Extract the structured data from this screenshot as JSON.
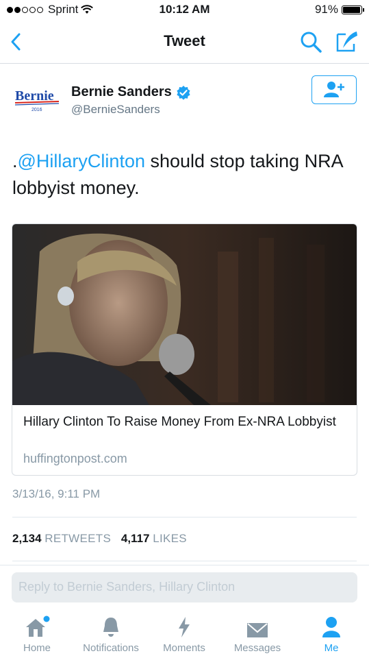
{
  "status_bar": {
    "carrier": "Sprint",
    "time": "10:12 AM",
    "battery": "91%"
  },
  "nav": {
    "title": "Tweet"
  },
  "author": {
    "avatar_logo_text": "Bernie",
    "avatar_year": "2016",
    "name": "Bernie Sanders",
    "handle": "@BernieSanders",
    "verified": true
  },
  "tweet": {
    "prefix": ".",
    "mention": "@HillaryClinton",
    "text": " should stop taking NRA lobbyist money."
  },
  "card": {
    "headline": "Hillary Clinton To Raise Money From Ex-NRA Lobbyist",
    "domain": "huffingtonpost.com"
  },
  "timestamp": "3/13/16, 9:11 PM",
  "stats": {
    "retweets_count": "2,134",
    "retweets_label": "RETWEETS",
    "likes_count": "4,117",
    "likes_label": "LIKES"
  },
  "reply": {
    "placeholder": "Reply to Bernie Sanders, Hillary Clinton"
  },
  "tabs": [
    {
      "label": "Home",
      "icon": "home-icon"
    },
    {
      "label": "Notifications",
      "icon": "bell-icon"
    },
    {
      "label": "Moments",
      "icon": "lightning-icon"
    },
    {
      "label": "Messages",
      "icon": "envelope-icon"
    },
    {
      "label": "Me",
      "icon": "person-icon",
      "active": true
    }
  ],
  "colors": {
    "accent": "#1da1f2",
    "muted": "#8899a6",
    "text": "#14171a"
  }
}
